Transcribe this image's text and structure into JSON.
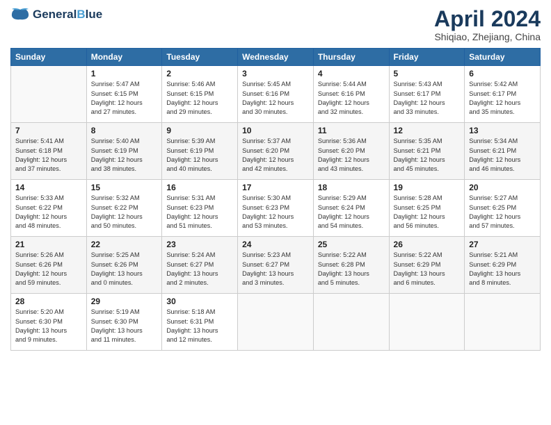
{
  "logo": {
    "line1": "General",
    "line2": "Blue"
  },
  "title": "April 2024",
  "subtitle": "Shiqiao, Zhejiang, China",
  "weekdays": [
    "Sunday",
    "Monday",
    "Tuesday",
    "Wednesday",
    "Thursday",
    "Friday",
    "Saturday"
  ],
  "weeks": [
    [
      {
        "day": "",
        "info": ""
      },
      {
        "day": "1",
        "info": "Sunrise: 5:47 AM\nSunset: 6:15 PM\nDaylight: 12 hours\nand 27 minutes."
      },
      {
        "day": "2",
        "info": "Sunrise: 5:46 AM\nSunset: 6:15 PM\nDaylight: 12 hours\nand 29 minutes."
      },
      {
        "day": "3",
        "info": "Sunrise: 5:45 AM\nSunset: 6:16 PM\nDaylight: 12 hours\nand 30 minutes."
      },
      {
        "day": "4",
        "info": "Sunrise: 5:44 AM\nSunset: 6:16 PM\nDaylight: 12 hours\nand 32 minutes."
      },
      {
        "day": "5",
        "info": "Sunrise: 5:43 AM\nSunset: 6:17 PM\nDaylight: 12 hours\nand 33 minutes."
      },
      {
        "day": "6",
        "info": "Sunrise: 5:42 AM\nSunset: 6:17 PM\nDaylight: 12 hours\nand 35 minutes."
      }
    ],
    [
      {
        "day": "7",
        "info": "Sunrise: 5:41 AM\nSunset: 6:18 PM\nDaylight: 12 hours\nand 37 minutes."
      },
      {
        "day": "8",
        "info": "Sunrise: 5:40 AM\nSunset: 6:19 PM\nDaylight: 12 hours\nand 38 minutes."
      },
      {
        "day": "9",
        "info": "Sunrise: 5:39 AM\nSunset: 6:19 PM\nDaylight: 12 hours\nand 40 minutes."
      },
      {
        "day": "10",
        "info": "Sunrise: 5:37 AM\nSunset: 6:20 PM\nDaylight: 12 hours\nand 42 minutes."
      },
      {
        "day": "11",
        "info": "Sunrise: 5:36 AM\nSunset: 6:20 PM\nDaylight: 12 hours\nand 43 minutes."
      },
      {
        "day": "12",
        "info": "Sunrise: 5:35 AM\nSunset: 6:21 PM\nDaylight: 12 hours\nand 45 minutes."
      },
      {
        "day": "13",
        "info": "Sunrise: 5:34 AM\nSunset: 6:21 PM\nDaylight: 12 hours\nand 46 minutes."
      }
    ],
    [
      {
        "day": "14",
        "info": "Sunrise: 5:33 AM\nSunset: 6:22 PM\nDaylight: 12 hours\nand 48 minutes."
      },
      {
        "day": "15",
        "info": "Sunrise: 5:32 AM\nSunset: 6:22 PM\nDaylight: 12 hours\nand 50 minutes."
      },
      {
        "day": "16",
        "info": "Sunrise: 5:31 AM\nSunset: 6:23 PM\nDaylight: 12 hours\nand 51 minutes."
      },
      {
        "day": "17",
        "info": "Sunrise: 5:30 AM\nSunset: 6:23 PM\nDaylight: 12 hours\nand 53 minutes."
      },
      {
        "day": "18",
        "info": "Sunrise: 5:29 AM\nSunset: 6:24 PM\nDaylight: 12 hours\nand 54 minutes."
      },
      {
        "day": "19",
        "info": "Sunrise: 5:28 AM\nSunset: 6:25 PM\nDaylight: 12 hours\nand 56 minutes."
      },
      {
        "day": "20",
        "info": "Sunrise: 5:27 AM\nSunset: 6:25 PM\nDaylight: 12 hours\nand 57 minutes."
      }
    ],
    [
      {
        "day": "21",
        "info": "Sunrise: 5:26 AM\nSunset: 6:26 PM\nDaylight: 12 hours\nand 59 minutes."
      },
      {
        "day": "22",
        "info": "Sunrise: 5:25 AM\nSunset: 6:26 PM\nDaylight: 13 hours\nand 0 minutes."
      },
      {
        "day": "23",
        "info": "Sunrise: 5:24 AM\nSunset: 6:27 PM\nDaylight: 13 hours\nand 2 minutes."
      },
      {
        "day": "24",
        "info": "Sunrise: 5:23 AM\nSunset: 6:27 PM\nDaylight: 13 hours\nand 3 minutes."
      },
      {
        "day": "25",
        "info": "Sunrise: 5:22 AM\nSunset: 6:28 PM\nDaylight: 13 hours\nand 5 minutes."
      },
      {
        "day": "26",
        "info": "Sunrise: 5:22 AM\nSunset: 6:29 PM\nDaylight: 13 hours\nand 6 minutes."
      },
      {
        "day": "27",
        "info": "Sunrise: 5:21 AM\nSunset: 6:29 PM\nDaylight: 13 hours\nand 8 minutes."
      }
    ],
    [
      {
        "day": "28",
        "info": "Sunrise: 5:20 AM\nSunset: 6:30 PM\nDaylight: 13 hours\nand 9 minutes."
      },
      {
        "day": "29",
        "info": "Sunrise: 5:19 AM\nSunset: 6:30 PM\nDaylight: 13 hours\nand 11 minutes."
      },
      {
        "day": "30",
        "info": "Sunrise: 5:18 AM\nSunset: 6:31 PM\nDaylight: 13 hours\nand 12 minutes."
      },
      {
        "day": "",
        "info": ""
      },
      {
        "day": "",
        "info": ""
      },
      {
        "day": "",
        "info": ""
      },
      {
        "day": "",
        "info": ""
      }
    ]
  ]
}
